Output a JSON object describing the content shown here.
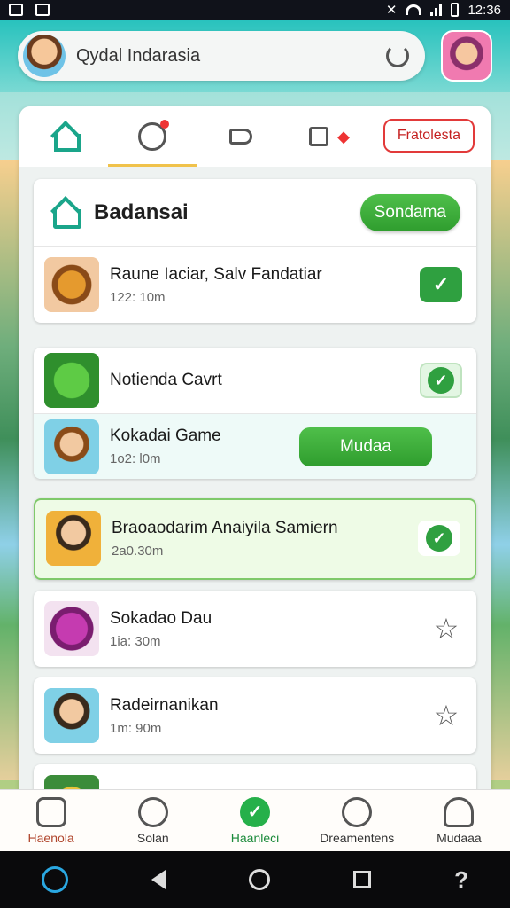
{
  "status_bar": {
    "time": "12:36"
  },
  "search": {
    "query": "Qydal Indarasia"
  },
  "tabs": {
    "badge_button": "Fratolesta"
  },
  "section": {
    "title": "Badansai",
    "action_label": "Sondama"
  },
  "items": [
    {
      "title": "Raune Iaciar, Salv Fandatiar",
      "subtitle": "122: 10m"
    },
    {
      "title": "Notienda Cavrt",
      "subtitle": ""
    },
    {
      "title": "Kokadai Game",
      "subtitle": "1o2: l0m",
      "action_label": "Mudaa"
    },
    {
      "title": "Braoaodarim Anaiyila Samiern",
      "subtitle": "2a0.30m"
    },
    {
      "title": "Sokadao Dau",
      "subtitle": "1ia: 30m"
    },
    {
      "title": "Radeirnanikan",
      "subtitle": "1m: 90m"
    }
  ],
  "bottom_nav": [
    {
      "label": "Haenola"
    },
    {
      "label": "Solan"
    },
    {
      "label": "Haanleci"
    },
    {
      "label": "Dreamentens"
    },
    {
      "label": "Mudaaa"
    }
  ],
  "colors": {
    "accent": "#2fa040",
    "teal": "#1aa58a",
    "alert": "#e23a3a"
  }
}
